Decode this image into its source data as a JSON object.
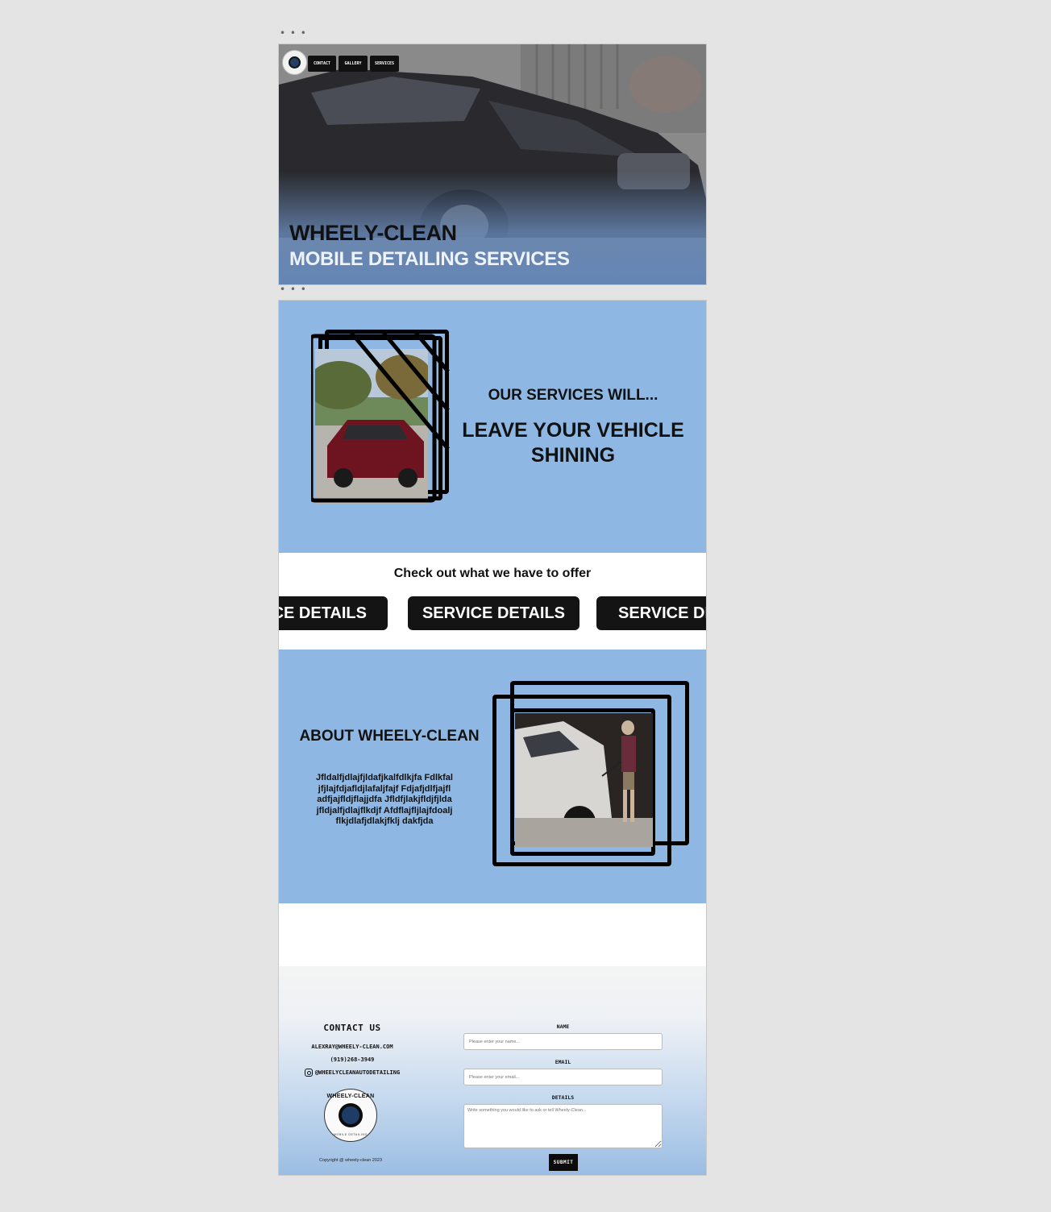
{
  "hero": {
    "nav": [
      {
        "label": "CONTACT"
      },
      {
        "label": "GALLERY"
      },
      {
        "label": "SERVICES"
      }
    ],
    "title": "WHEELY-CLEAN",
    "subtitle": "MOBILE DETAILING SERVICES"
  },
  "services": {
    "intro": "OUR SERVICES WILL...",
    "headline": "LEAVE YOUR VEHICLE SHINING"
  },
  "offer": {
    "title": "Check out what we have to offer",
    "buttons": [
      {
        "label": "SERVICE DETAILS"
      },
      {
        "label": "SERVICE DETAILS"
      },
      {
        "label": "SERVICE DETAILS"
      }
    ]
  },
  "about": {
    "title": "ABOUT WHEELY-CLEAN",
    "text": "Jfldalfjdlajfjldafjkalfdlkjfa Fdlkfaljfjlajfdjafldjlafaljfajf Fdjafjdlfjajfladfjajfldjflajjdfa Jfldfjlakjfldjfjldajfldjalfjdlajflkdjf Afdflajfljlajfdoaljflkjdlafjdlakjfklj dakfjda"
  },
  "footer": {
    "contact_title": "CONTACT US",
    "email": "ALEXRAY@WHEELY-CLEAN.COM",
    "phone": "(919)268-3949",
    "instagram": "@WHEELYCLEANAUTODETAILING",
    "logo_top_text": "WHEELY-CLEAN",
    "logo_bottom_text": "MOBILE DETAILING",
    "copyright": "Copyright @ wheely-clean 2023",
    "form": {
      "name_label": "NAME",
      "name_placeholder": "Please enter your name...",
      "email_label": "EMAIL",
      "email_placeholder": "Please enter your email...",
      "details_label": "DETAILS",
      "details_placeholder": "Write something you would like to ask or tell Wheely-Clean...",
      "submit_label": "SUBMIT"
    }
  },
  "colors": {
    "section_blue": "#8eb8e3",
    "button_black": "#141414",
    "page_background": "#e4e4e4"
  }
}
